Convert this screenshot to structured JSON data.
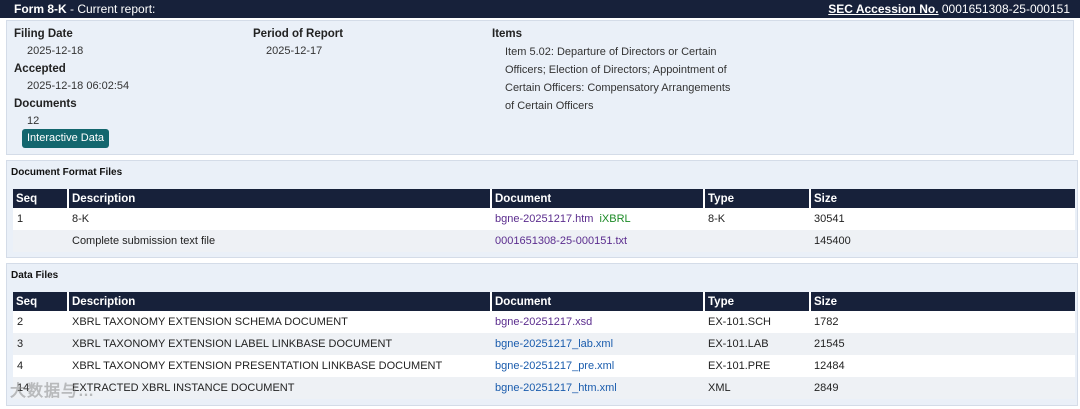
{
  "titlebar": {
    "form": "Form 8-K",
    "suffix": " - Current report:",
    "accession_label": "SEC Accession No.",
    "accession_number": "0001651308-25-000151"
  },
  "filing": {
    "filing_date_label": "Filing Date",
    "filing_date": "2025-12-18",
    "accepted_label": "Accepted",
    "accepted": "2025-12-18 06:02:54",
    "documents_label": "Documents",
    "documents": "12",
    "interactive_data_button": "Interactive Data",
    "period_label": "Period of Report",
    "period": "2025-12-17",
    "items_label": "Items",
    "items_text": "Item 5.02: Departure of Directors or Certain Officers; Election of Directors; Appointment of Certain Officers: Compensatory Arrangements of Certain Officers"
  },
  "doc_format_files": {
    "title": "Document Format Files",
    "headers": [
      "Seq",
      "Description",
      "Document",
      "Type",
      "Size"
    ],
    "rows": [
      {
        "seq": "1",
        "description": "8-K",
        "document": "bgne-20251217.htm",
        "ixbrl": "iXBRL",
        "type": "8-K",
        "size": "30541"
      },
      {
        "seq": "",
        "description": "Complete submission text file",
        "document": "0001651308-25-000151.txt",
        "ixbrl": "",
        "type": "",
        "size": "145400"
      }
    ]
  },
  "data_files": {
    "title": "Data Files",
    "headers": [
      "Seq",
      "Description",
      "Document",
      "Type",
      "Size"
    ],
    "rows": [
      {
        "seq": "2",
        "description": "XBRL TAXONOMY EXTENSION SCHEMA DOCUMENT",
        "document": "bgne-20251217.xsd",
        "type": "EX-101.SCH",
        "size": "1782"
      },
      {
        "seq": "3",
        "description": "XBRL TAXONOMY EXTENSION LABEL LINKBASE DOCUMENT",
        "document": "bgne-20251217_lab.xml",
        "type": "EX-101.LAB",
        "size": "21545"
      },
      {
        "seq": "4",
        "description": "XBRL TAXONOMY EXTENSION PRESENTATION LINKBASE DOCUMENT",
        "document": "bgne-20251217_pre.xml",
        "type": "EX-101.PRE",
        "size": "12484"
      },
      {
        "seq": "14",
        "description": "EXTRACTED XBRL INSTANCE DOCUMENT",
        "document": "bgne-20251217_htm.xml",
        "type": "XML",
        "size": "2849"
      }
    ]
  },
  "watermark": "大数据与…"
}
